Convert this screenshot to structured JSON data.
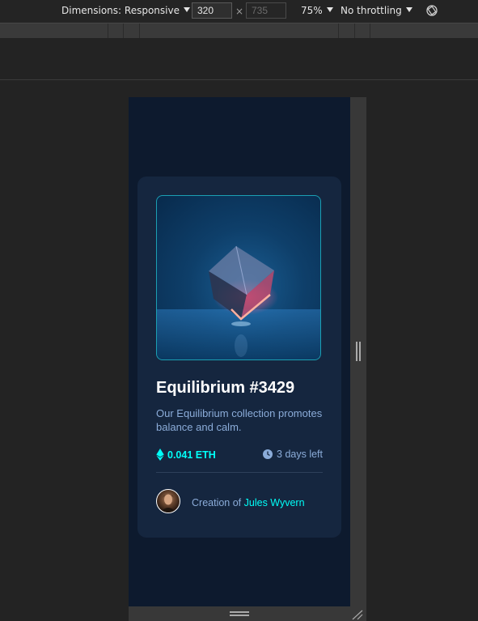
{
  "toolbar": {
    "dimensions_label": "Dimensions: Responsive",
    "width_value": "320",
    "height_value": "735",
    "times": "×",
    "zoom": "75%",
    "throttling": "No throttling",
    "rotate_icon": "rotate-icon"
  },
  "card": {
    "image_alt": "equilibrium-cube-image",
    "title": "Equilibrium #3429",
    "description": "Our Equilibrium collection promotes balance and calm.",
    "price": "0.041 ETH",
    "time_left": "3 days left",
    "creator_prefix": "Creation of",
    "creator_name": "Jules Wyvern"
  },
  "colors": {
    "page_bg": "#0d1a2e",
    "card_bg": "#15263f",
    "cyan": "#00fff8",
    "soft_blue": "#8bacd9"
  },
  "icons": [
    "ethereum-icon",
    "clock-icon",
    "rotate-icon"
  ]
}
